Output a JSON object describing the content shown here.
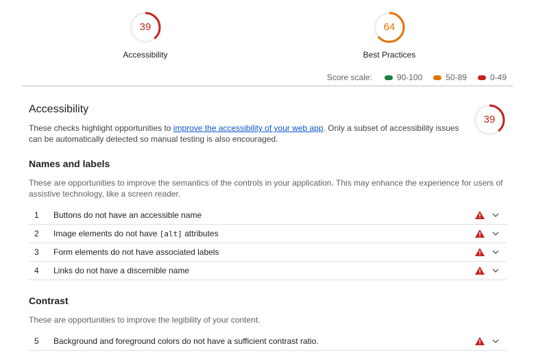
{
  "gauges": [
    {
      "value": "39",
      "label": "Accessibility",
      "color": "#c5221f"
    },
    {
      "value": "64",
      "label": "Best Practices",
      "color": "#e37400"
    }
  ],
  "score_scale": {
    "title": "Score scale:",
    "items": [
      {
        "label": "90-100",
        "color": "#188038"
      },
      {
        "label": "50-89",
        "color": "#e37400"
      },
      {
        "label": "0-49",
        "color": "#c5221f"
      }
    ]
  },
  "section": {
    "title": "Accessibility",
    "score": "39",
    "desc_before": "These checks highlight opportunities to ",
    "desc_link": "improve the accessibility of your web app",
    "desc_after": ". Only a subset of accessibility issues can be automatically detected so manual testing is also encouraged."
  },
  "groups": [
    {
      "title": "Names and labels",
      "description": "These are opportunities to improve the semantics of the controls in your application. This may enhance the experience for users of assistive technology, like a screen reader.",
      "audits": [
        {
          "num": "1",
          "title": "Buttons do not have an accessible name"
        },
        {
          "num": "2",
          "title_before": "Image elements do not have ",
          "code": "[alt]",
          "title_after": " attributes"
        },
        {
          "num": "3",
          "title": "Form elements do not have associated labels"
        },
        {
          "num": "4",
          "title": "Links do not have a discernible name"
        }
      ]
    },
    {
      "title": "Contrast",
      "description": "These are opportunities to improve the legibility of your content.",
      "audits": [
        {
          "num": "5",
          "title": "Background and foreground colors do not have a sufficient contrast ratio."
        }
      ]
    }
  ],
  "icons": {
    "warning": "warning-triangle-icon",
    "expand": "chevron-down-icon"
  }
}
